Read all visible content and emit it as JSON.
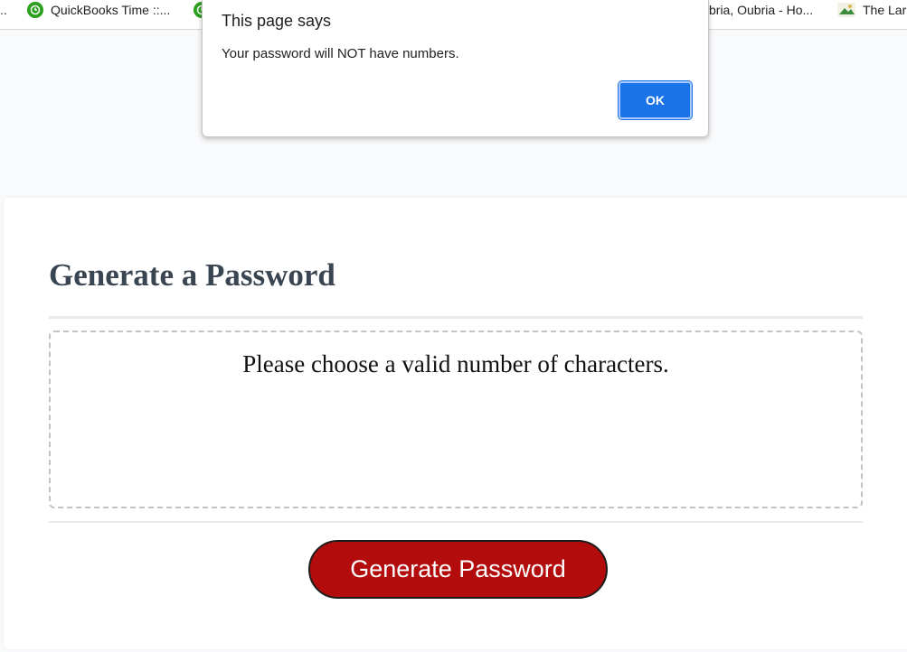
{
  "bookmarks": {
    "items": [
      {
        "label": "..",
        "icon": "none"
      },
      {
        "label": "QuickBooks Time ::...",
        "icon": "quickbooks-time-icon"
      },
      {
        "label": "",
        "icon": "quickbooks-time-icon"
      },
      {
        "label": "bria, Oubria - Ho...",
        "icon": "none"
      },
      {
        "label": "The Lar",
        "icon": "landscape-icon"
      }
    ]
  },
  "dialog": {
    "title": "This page says",
    "message": "Your password will NOT have numbers.",
    "ok_label": "OK"
  },
  "card": {
    "title": "Generate a Password",
    "password_text": "Please choose a valid number of characters.",
    "generate_label": "Generate Password"
  },
  "colors": {
    "accent_button": "#b30c0c",
    "dialog_button": "#1a73e8",
    "title_color": "#3a4552",
    "quickbooks_green": "#2ca01c"
  }
}
